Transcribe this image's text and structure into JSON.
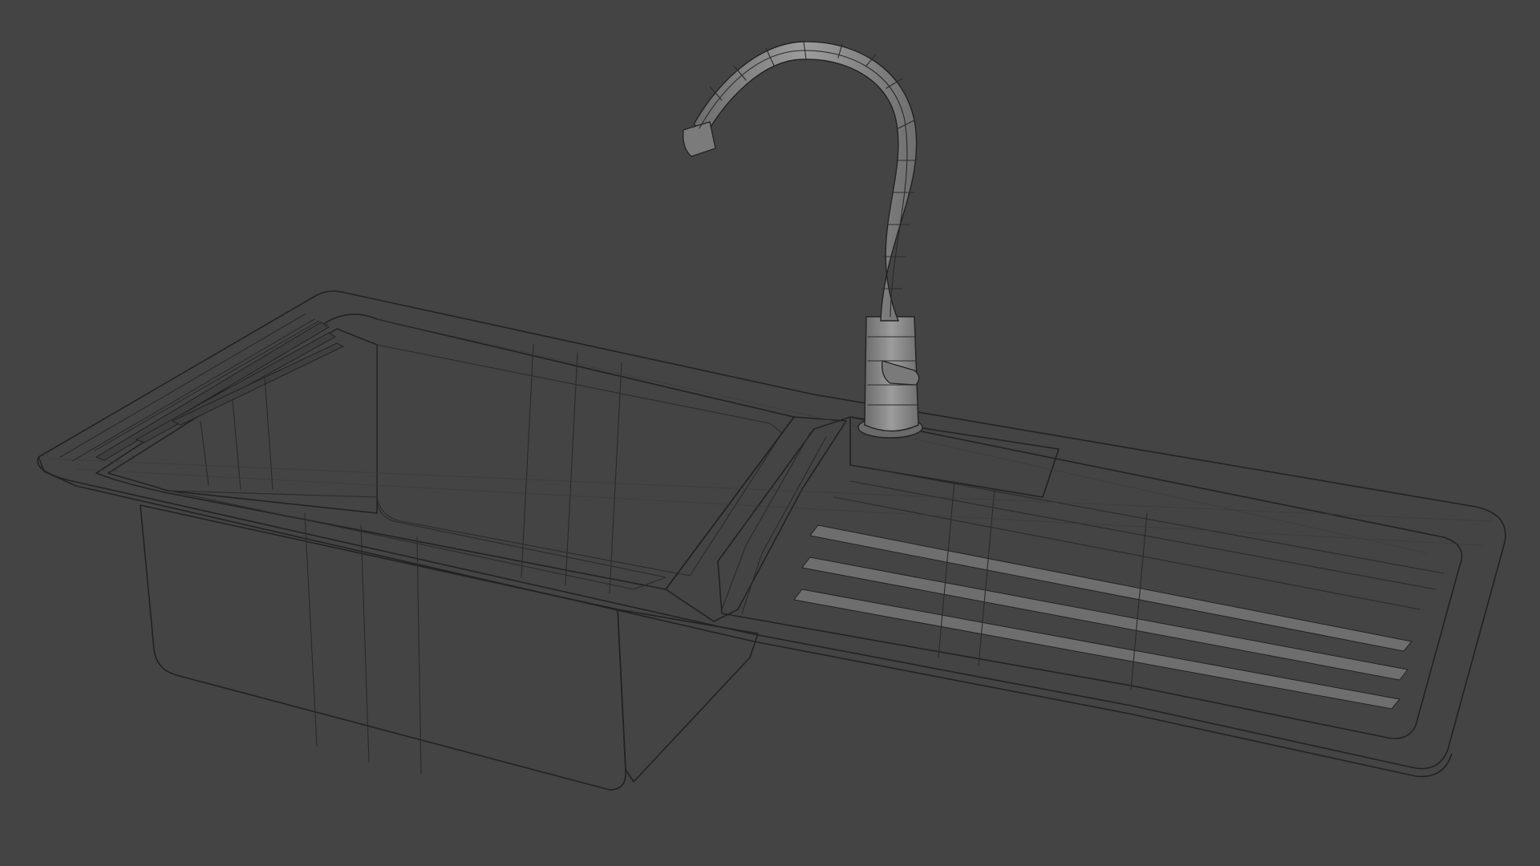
{
  "scene": {
    "background_color": "#444444",
    "surface_color": "#8c8c8c",
    "wire_color": "#2a2a2a",
    "objects": [
      {
        "name": "kitchen-sink",
        "type": "mesh"
      },
      {
        "name": "faucet",
        "type": "mesh"
      }
    ]
  }
}
